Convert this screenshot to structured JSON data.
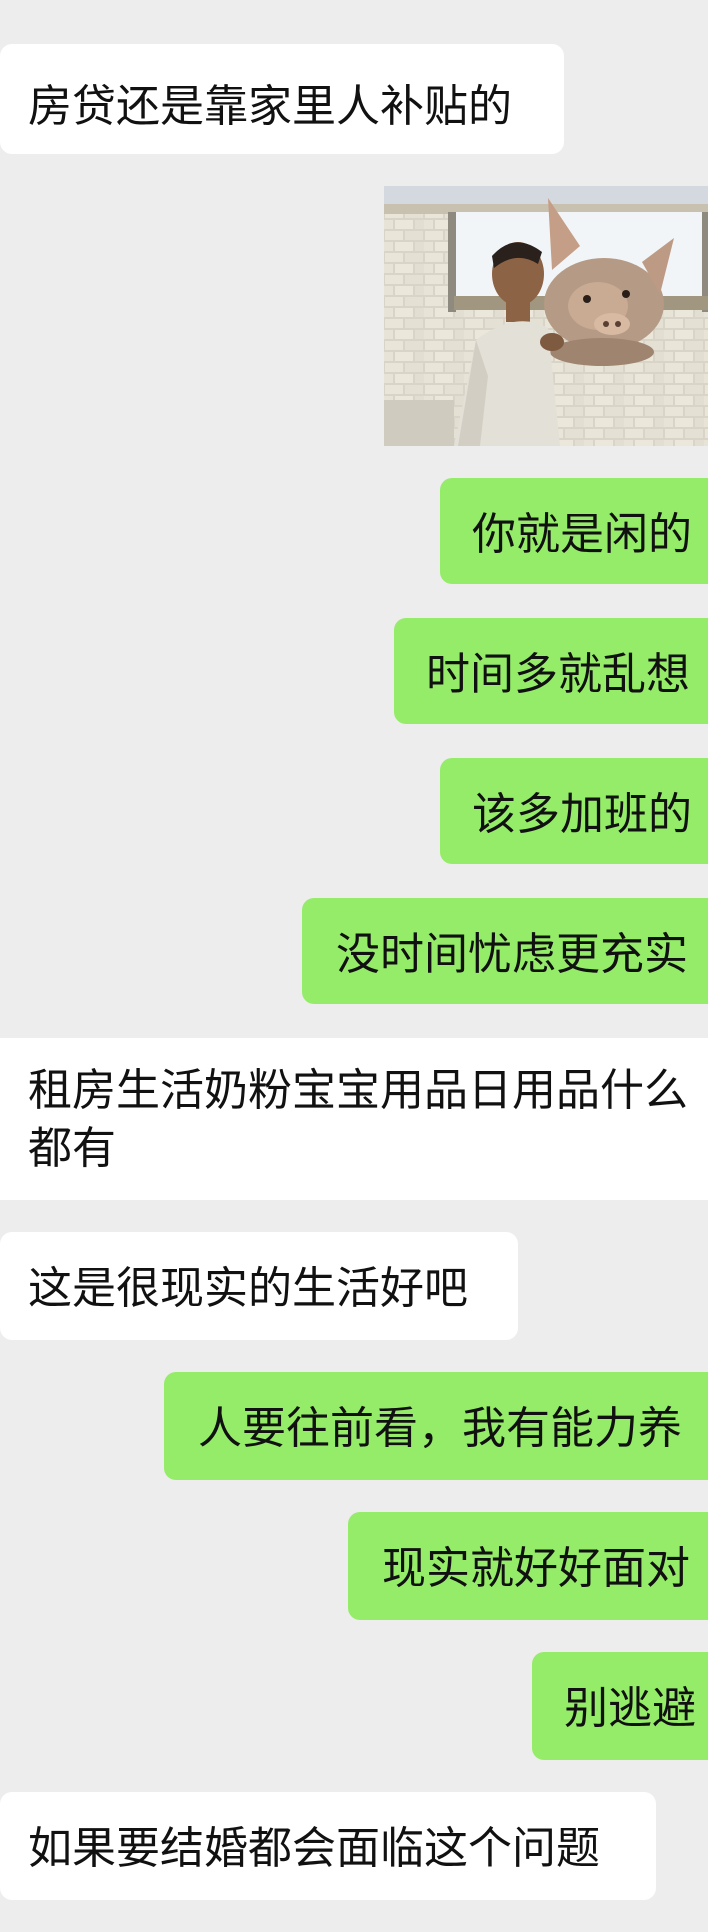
{
  "messages": [
    {
      "side": "left",
      "text": "房贷还是靠家里人补贴的"
    },
    {
      "side": "right",
      "type": "image",
      "icon": "pig-meme-image"
    },
    {
      "side": "right",
      "text": "你就是闲的"
    },
    {
      "side": "right",
      "text": "时间多就乱想"
    },
    {
      "side": "right",
      "text": "该多加班的"
    },
    {
      "side": "right",
      "text": "没时间忧虑更充实"
    },
    {
      "side": "left",
      "text": "租房生活奶粉宝宝用品日用品什么都有"
    },
    {
      "side": "left",
      "text": "这是很现实的生活好吧"
    },
    {
      "side": "right",
      "text": "人要往前看，我有能力养"
    },
    {
      "side": "right",
      "text": "现实就好好面对"
    },
    {
      "side": "right",
      "text": "别逃避"
    },
    {
      "side": "left",
      "text": "如果要结婚都会面临这个问题"
    }
  ],
  "colors": {
    "background": "#ededed",
    "incoming_bubble": "#ffffff",
    "outgoing_bubble": "#95ec69"
  }
}
